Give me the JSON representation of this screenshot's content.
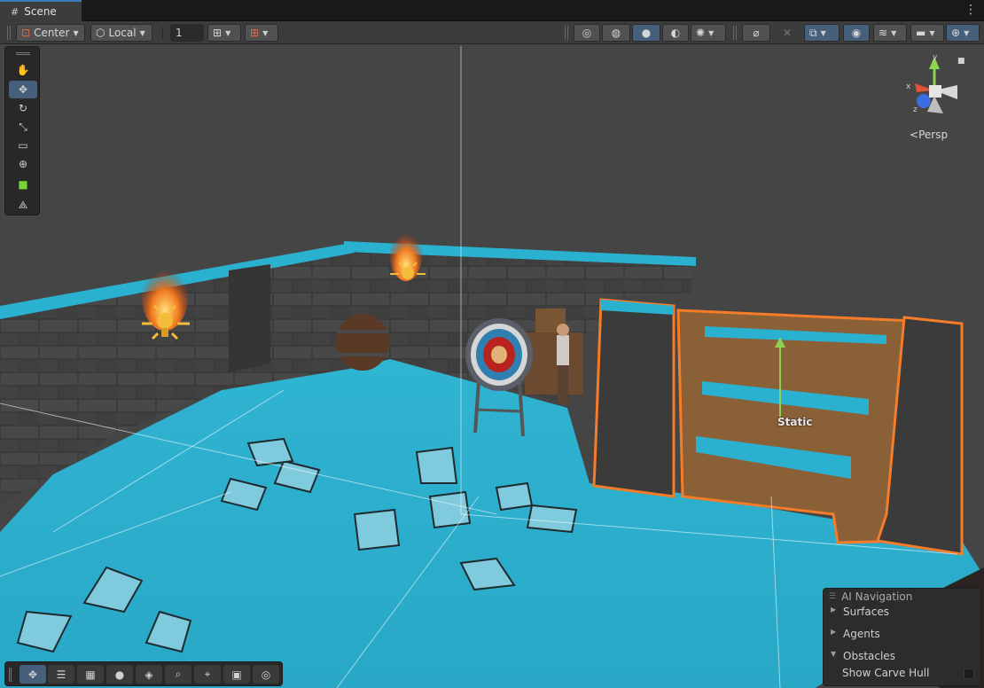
{
  "tab": {
    "label": "Scene",
    "icon": "grid-icon"
  },
  "toolbar": {
    "pivot_label": "Center",
    "space_label": "Local",
    "snap_value": "1"
  },
  "tools": [
    {
      "name": "hand-tool",
      "icon": "hand-icon",
      "glyph": "✋"
    },
    {
      "name": "move-tool",
      "icon": "move-icon",
      "glyph": "✥",
      "active": true
    },
    {
      "name": "rotate-tool",
      "icon": "rotate-icon",
      "glyph": "↻"
    },
    {
      "name": "scale-tool",
      "icon": "scale-icon",
      "glyph": "⤡"
    },
    {
      "name": "rect-tool",
      "icon": "rect-icon",
      "glyph": "▭"
    },
    {
      "name": "transform-tool",
      "icon": "transform-icon",
      "glyph": "⊕"
    },
    {
      "name": "navmesh-tool",
      "icon": "navmesh-cube-icon",
      "glyph": "■"
    },
    {
      "name": "custom-tool",
      "icon": "custom-tool-icon",
      "glyph": "⟁"
    }
  ],
  "gizmo": {
    "persp_label": "Persp",
    "x_label": "x",
    "y_label": "y",
    "z_label": "z"
  },
  "scene": {
    "static_label": "Static"
  },
  "ai_navigation": {
    "title": "AI Navigation",
    "items": [
      {
        "label": "Surfaces",
        "expanded": false
      },
      {
        "label": "Agents",
        "expanded": false
      },
      {
        "label": "Obstacles",
        "expanded": true
      }
    ],
    "show_carve_hull_label": "Show Carve Hull",
    "show_carve_hull_checked": false
  },
  "bottom_tools": [
    {
      "name": "bottom-move-tool",
      "glyph": "✥",
      "active": true
    },
    {
      "name": "bottom-settings-tool",
      "glyph": "☰"
    },
    {
      "name": "bottom-grid-tool",
      "glyph": "▦"
    },
    {
      "name": "bottom-sphere-tool",
      "glyph": "●"
    },
    {
      "name": "bottom-layers-tool",
      "glyph": "◈"
    },
    {
      "name": "bottom-search-tool",
      "glyph": "⌕"
    },
    {
      "name": "bottom-pivot-tool",
      "glyph": "⌖"
    },
    {
      "name": "bottom-camera-tool",
      "glyph": "▣"
    },
    {
      "name": "bottom-compass-tool",
      "glyph": "◎"
    }
  ],
  "colors": {
    "navmesh": "#2ab1cf",
    "selection": "#f57c28",
    "accent": "#46607c"
  }
}
